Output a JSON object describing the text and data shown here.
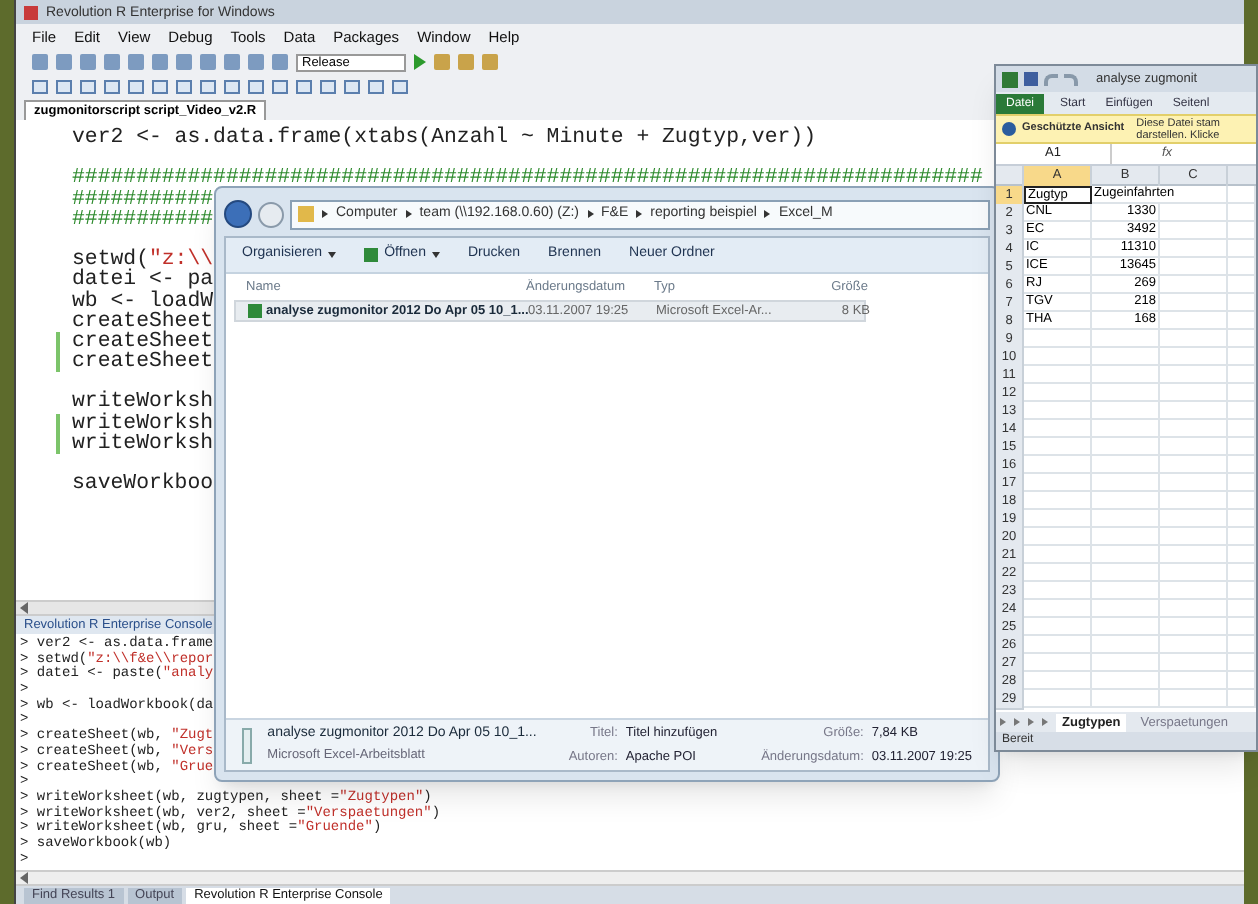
{
  "ide": {
    "title": "Revolution R Enterprise for Windows",
    "menu": [
      "File",
      "Edit",
      "View",
      "Debug",
      "Tools",
      "Data",
      "Packages",
      "Window",
      "Help"
    ],
    "configuration": "Release",
    "file_tab": {
      "label": "zugmonitorscript script_Video_v2.R",
      "selected": true
    },
    "editor_lines": [
      {
        "changed": false,
        "parts": [
          {
            "kind": "code",
            "text": "ver2 <- as.data.frame(xtabs(Anzahl ~ Minute + Zugtyp,ver))"
          }
        ]
      },
      {
        "changed": false
      },
      {
        "changed": false,
        "parts": [
          {
            "kind": "comment",
            "text": "#######################################################################"
          }
        ]
      },
      {
        "changed": false,
        "parts": [
          {
            "kind": "comment",
            "text": "###########"
          }
        ]
      },
      {
        "changed": false,
        "parts": [
          {
            "kind": "comment",
            "text": "###########"
          }
        ]
      },
      {
        "changed": false
      },
      {
        "changed": false,
        "parts": [
          {
            "kind": "code",
            "text": "setwd("
          },
          {
            "kind": "string",
            "text": "\"z:\\\\"
          }
        ]
      },
      {
        "changed": false,
        "parts": [
          {
            "kind": "code",
            "text": "datei <- pa"
          }
        ]
      },
      {
        "changed": false,
        "parts": [
          {
            "kind": "code",
            "text": "wb <- loadW"
          }
        ]
      },
      {
        "changed": false,
        "parts": [
          {
            "kind": "code",
            "text": "createSheet"
          }
        ]
      },
      {
        "changed": true,
        "parts": [
          {
            "kind": "code",
            "text": "createSheet"
          }
        ]
      },
      {
        "changed": true,
        "parts": [
          {
            "kind": "code",
            "text": "createSheet"
          }
        ]
      },
      {
        "changed": false
      },
      {
        "changed": false,
        "parts": [
          {
            "kind": "code",
            "text": "writeWorksh"
          }
        ]
      },
      {
        "changed": true,
        "parts": [
          {
            "kind": "code",
            "text": "writeWorksh"
          }
        ]
      },
      {
        "changed": true,
        "parts": [
          {
            "kind": "code",
            "text": "writeWorksh"
          }
        ]
      },
      {
        "changed": false
      },
      {
        "changed": false,
        "parts": [
          {
            "kind": "code",
            "text": "saveWorkboo"
          }
        ]
      }
    ],
    "console_title": "Revolution R Enterprise Console",
    "console_lines": [
      [
        {
          "kind": "code",
          "text": "> ver2 <- as.data.frame"
        }
      ],
      [
        {
          "kind": "code",
          "text": "> setwd("
        },
        {
          "kind": "string",
          "text": "\"z:\\\\f&e\\\\repor"
        }
      ],
      [
        {
          "kind": "code",
          "text": "> datei <- paste("
        },
        {
          "kind": "string",
          "text": "\"analy"
        }
      ],
      [
        {
          "kind": "code",
          "text": ">"
        }
      ],
      [
        {
          "kind": "code",
          "text": "> wb <- loadWorkbook(da"
        }
      ],
      [
        {
          "kind": "code",
          "text": ">"
        }
      ],
      [
        {
          "kind": "code",
          "text": "> createSheet(wb, "
        },
        {
          "kind": "string",
          "text": "\"Zugt"
        }
      ],
      [
        {
          "kind": "code",
          "text": "> createSheet(wb, "
        },
        {
          "kind": "string",
          "text": "\"Vers"
        }
      ],
      [
        {
          "kind": "code",
          "text": "> createSheet(wb, "
        },
        {
          "kind": "string",
          "text": "\"Grue"
        }
      ],
      [
        {
          "kind": "code",
          "text": ">"
        }
      ],
      [
        {
          "kind": "code",
          "text": "> writeWorksheet(wb, zugtypen, sheet ="
        },
        {
          "kind": "string",
          "text": "\"Zugtypen\""
        },
        {
          "kind": "code",
          "text": ")"
        }
      ],
      [
        {
          "kind": "code",
          "text": "> writeWorksheet(wb, ver2, sheet ="
        },
        {
          "kind": "string",
          "text": "\"Verspaetungen\""
        },
        {
          "kind": "code",
          "text": ")"
        }
      ],
      [
        {
          "kind": "code",
          "text": "> writeWorksheet(wb, gru, sheet ="
        },
        {
          "kind": "string",
          "text": "\"Gruende\""
        },
        {
          "kind": "code",
          "text": ")"
        }
      ],
      [
        {
          "kind": "code",
          "text": "> saveWorkbook(wb)"
        }
      ],
      [
        {
          "kind": "code",
          "text": ">"
        }
      ]
    ],
    "bottom_tabs": [
      {
        "label": "Find Results 1",
        "selected": false
      },
      {
        "label": "Output",
        "selected": false
      },
      {
        "label": "Revolution R Enterprise Console",
        "selected": true
      }
    ]
  },
  "explorer": {
    "breadcrumb": [
      "Computer",
      "team (\\\\192.168.0.60) (Z:)",
      "F&E",
      "reporting beispiel",
      "Excel_M"
    ],
    "toolbar": [
      {
        "label": "Organisieren",
        "dropdown": true
      },
      {
        "label": "Öffnen",
        "dropdown": true
      },
      {
        "label": "Drucken",
        "dropdown": false
      },
      {
        "label": "Brennen",
        "dropdown": false
      },
      {
        "label": "Neuer Ordner",
        "dropdown": false
      }
    ],
    "columns": [
      "Name",
      "Änderungsdatum",
      "Typ",
      "Größe"
    ],
    "files": [
      {
        "name": "analyse zugmonitor 2012 Do Apr 05 10_1...",
        "modified": "03.11.2007 19:25",
        "type": "Microsoft Excel-Ar...",
        "size": "8 KB",
        "selected": true
      }
    ],
    "details": {
      "name": "analyse zugmonitor 2012 Do Apr 05 10_1...",
      "type": "Microsoft Excel-Arbeitsblatt",
      "fields": [
        {
          "label": "Titel:",
          "value": "Titel hinzufügen"
        },
        {
          "label": "Größe:",
          "value": "7,84 KB"
        },
        {
          "label": "Autoren:",
          "value": "Apache POI"
        },
        {
          "label": "Änderungsdatum:",
          "value": "03.11.2007 19:25"
        }
      ]
    }
  },
  "excel": {
    "title": "analyse zugmonit",
    "ribbon_tabs": [
      {
        "label": "Datei",
        "selected": true
      },
      {
        "label": "Start",
        "selected": false
      },
      {
        "label": "Einfügen",
        "selected": false
      },
      {
        "label": "Seitenl",
        "selected": false
      }
    ],
    "info_bar": {
      "title": "Geschützte Ansicht",
      "message": [
        "Diese Datei stam",
        "darstellen. Klicke"
      ]
    },
    "name_box": "A1",
    "fx": "fx",
    "columns": [
      {
        "label": "A",
        "selected": true
      },
      {
        "label": "B",
        "selected": false
      },
      {
        "label": "C",
        "selected": false
      }
    ],
    "rows": [
      {
        "number": "1",
        "selected": true,
        "kind": "header",
        "cells": [
          "Zugtyp",
          "Zugeinfahrten"
        ]
      },
      {
        "number": "2",
        "selected": false,
        "cells": [
          "CNL",
          "1330"
        ]
      },
      {
        "number": "3",
        "selected": false,
        "cells": [
          "EC",
          "3492"
        ]
      },
      {
        "number": "4",
        "selected": false,
        "cells": [
          "IC",
          "11310"
        ]
      },
      {
        "number": "5",
        "selected": false,
        "cells": [
          "ICE",
          "13645"
        ]
      },
      {
        "number": "6",
        "selected": false,
        "cells": [
          "RJ",
          "269"
        ]
      },
      {
        "number": "7",
        "selected": false,
        "cells": [
          "TGV",
          "218"
        ]
      },
      {
        "number": "8",
        "selected": false,
        "cells": [
          "THA",
          "168"
        ]
      },
      {
        "number": "9",
        "selected": false
      },
      {
        "number": "10",
        "selected": false
      },
      {
        "number": "11",
        "selected": false
      },
      {
        "number": "12",
        "selected": false
      },
      {
        "number": "13",
        "selected": false
      },
      {
        "number": "14",
        "selected": false
      },
      {
        "number": "15",
        "selected": false
      },
      {
        "number": "16",
        "selected": false
      },
      {
        "number": "17",
        "selected": false
      },
      {
        "number": "18",
        "selected": false
      },
      {
        "number": "19",
        "selected": false
      },
      {
        "number": "20",
        "selected": false
      },
      {
        "number": "21",
        "selected": false
      },
      {
        "number": "22",
        "selected": false
      },
      {
        "number": "23",
        "selected": false
      },
      {
        "number": "24",
        "selected": false
      },
      {
        "number": "25",
        "selected": false
      },
      {
        "number": "26",
        "selected": false
      },
      {
        "number": "27",
        "selected": false
      },
      {
        "number": "28",
        "selected": false
      },
      {
        "number": "29",
        "selected": false
      }
    ],
    "sheet_tabs": [
      {
        "label": "Zugtypen",
        "selected": true
      },
      {
        "label": "Verspaetungen",
        "selected": false
      }
    ],
    "status": "Bereit"
  }
}
